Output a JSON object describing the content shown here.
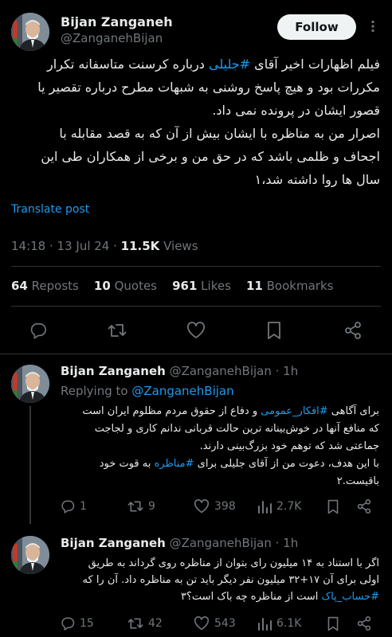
{
  "main": {
    "author_name": "Bijan Zanganeh",
    "author_handle": "@ZanganehBijan",
    "follow_label": "Follow",
    "lines": [
      [
        "فیلم اظهارات اخیر آقای ",
        "#جلیلی",
        " درباره کرسنت متاسفانه تکرار"
      ],
      [
        "مکررات بود و هیچ پاسخ روشنی به شبهات مطرح درباره تقصیر یا"
      ],
      [
        "قصور ایشان در پرونده نمی داد."
      ],
      [
        "اصرار من به مناظره با ایشان بیش از آن که به قصد مقابله با"
      ],
      [
        "اجحاف و ظلمی باشد که در حق من و برخی از همکاران طی این"
      ],
      [
        "سال ها روا داشته شد،۱"
      ]
    ],
    "translate_label": "Translate post",
    "time": "14:18",
    "date": "13 Jul 24",
    "views_count": "11.5K",
    "views_label": "Views",
    "reposts_count": "64",
    "reposts_label": "Reposts",
    "quotes_count": "10",
    "quotes_label": "Quotes",
    "likes_count": "961",
    "likes_label": "Likes",
    "bookmarks_count": "11",
    "bookmarks_label": "Bookmarks"
  },
  "replies": [
    {
      "author_name": "Bijan Zanganeh",
      "author_handle": "@ZanganehBijan",
      "time": "1h",
      "replying_to_label": "Replying to",
      "replying_to_handle": "@ZanganehBijan",
      "lines": [
        [
          "برای آگاهی ",
          "#افکار_عمومی",
          " و دفاع از حقوق مردم مظلوم ایران است"
        ],
        [
          "که منافع آنها در خوش‌بینانه ترین حالت قربانی ندانم کاری و لجاجت"
        ],
        [
          "جماعتی شد که توهم خود بزرگ‌بینی دارند."
        ],
        [
          "با این هدف، دعوت من از آقای جلیلی برای ",
          "#مناظره",
          " به قوت خود"
        ],
        [
          "باقیست.۲"
        ]
      ],
      "replies": "1",
      "reposts": "9",
      "likes": "398",
      "views": "2.7K"
    },
    {
      "author_name": "Bijan Zanganeh",
      "author_handle": "@ZanganehBijan",
      "time": "1h",
      "lines": [
        [
          "اگر با استناد به ۱۴ میلیون رای بتوان از مناظره روی گرداند به طریق"
        ],
        [
          "اولی برای آن ۱۷+۳۲ میلیون نفر دیگر باید تن به مناظره داد. آن را که"
        ],
        [
          "",
          "#حساب_پاک",
          " است از مناظره چه باک است؟۳"
        ]
      ],
      "replies": "15",
      "reposts": "42",
      "likes": "543",
      "views": "6.1K"
    }
  ],
  "colors": {
    "background": "#000000",
    "text": "#e7e9ea",
    "muted": "#71767b",
    "accent": "#1d9bf0",
    "divider": "#2f3336"
  },
  "icons": [
    "more-icon",
    "reply-icon",
    "repost-icon",
    "like-icon",
    "bookmark-icon",
    "share-icon",
    "views-icon"
  ]
}
